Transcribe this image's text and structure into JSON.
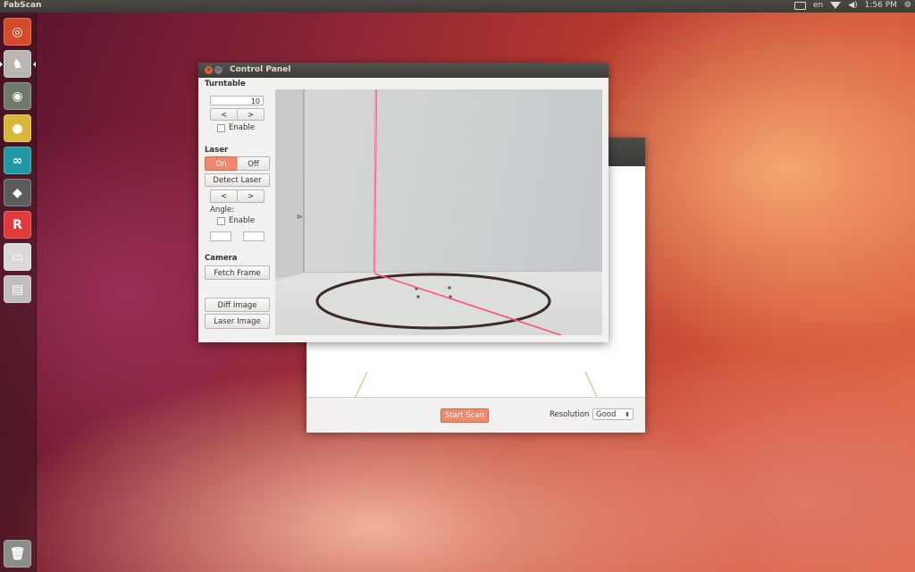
{
  "topbar": {
    "app_name": "FabScan",
    "keyboard_layout": "en",
    "time": "1:56 PM"
  },
  "launcher": {
    "items": [
      {
        "icon": "ubuntu-dash-icon",
        "glyph": "◎",
        "color": "#d64a2a"
      },
      {
        "icon": "fabscan-app-icon",
        "glyph": "♞",
        "color": "#b9b7b3"
      },
      {
        "icon": "eye-app-icon",
        "glyph": "◉",
        "color": "#6e7a6a"
      },
      {
        "icon": "sphere-app-icon",
        "glyph": "●",
        "color": "#d8b73a"
      },
      {
        "icon": "arduino-icon",
        "glyph": "∞",
        "color": "#1f9aa5"
      },
      {
        "icon": "printer-app-icon",
        "glyph": "◆",
        "color": "#5c5c5c"
      },
      {
        "icon": "repetier-app-icon",
        "glyph": "R",
        "color": "#e03a3a"
      },
      {
        "icon": "drive-icon",
        "glyph": "▭",
        "color": "#d9d9d9"
      },
      {
        "icon": "save-disk-icon",
        "glyph": "▤",
        "color": "#bfbfbf"
      }
    ],
    "trash_icon": "trash-icon"
  },
  "back_window": {
    "start_scan_label": "Start Scan",
    "resolution_label": "Resolution",
    "resolution_value": "Good"
  },
  "control_panel": {
    "title": "Control Panel",
    "turntable": {
      "heading": "Turntable",
      "steps_value": "10",
      "prev_label": "<",
      "next_label": ">",
      "enable_label": "Enable"
    },
    "laser": {
      "heading": "Laser",
      "on_label": "On",
      "off_label": "Off",
      "detect_label": "Detect Laser",
      "prev_label": "<",
      "next_label": ">",
      "angle_label": "Angle:",
      "enable_label": "Enable"
    },
    "camera": {
      "heading": "Camera",
      "fetch_label": "Fetch Frame",
      "diff_label": "Diff Image",
      "laser_image_label": "Laser Image"
    }
  }
}
